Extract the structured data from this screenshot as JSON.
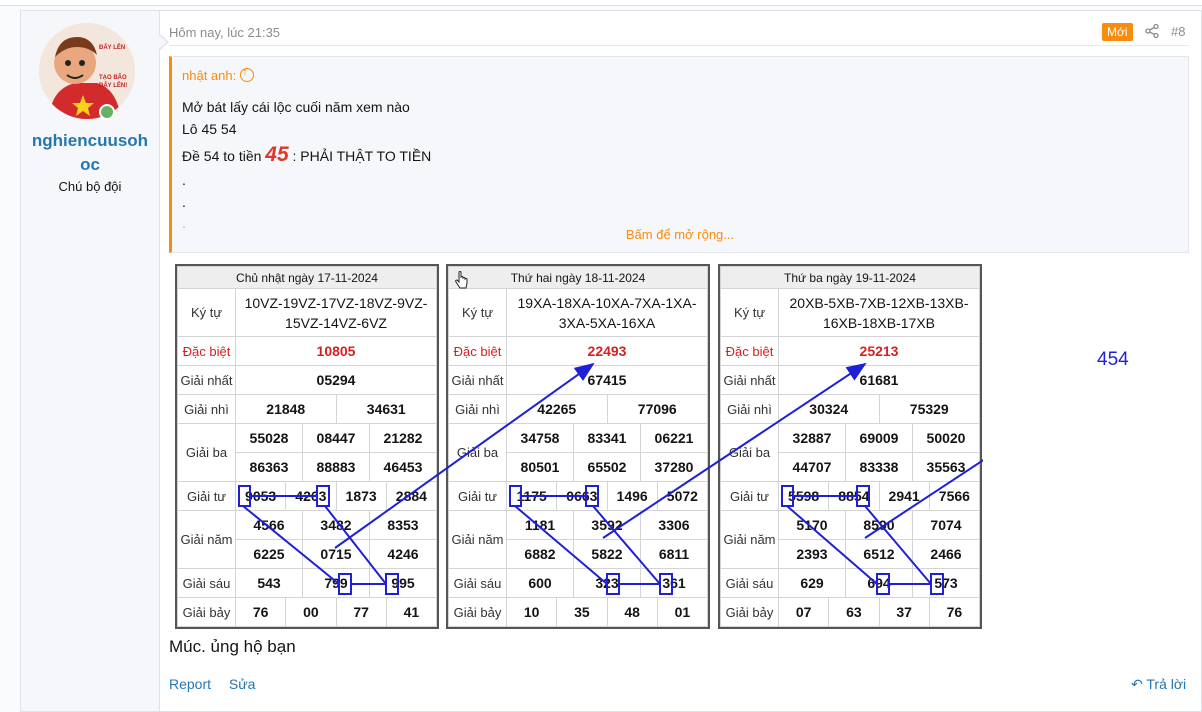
{
  "user": {
    "name": "nghiencuusohoc",
    "name_line1": "nghiencuusoh",
    "name_line2": "oc",
    "title": "Chú bộ đội",
    "avatar_text1": "ĐẨY LÊN",
    "avatar_text2": "TẠO BÃO",
    "avatar_text3": "ĐẨY LÊN!"
  },
  "post": {
    "date": "Hôm nay, lúc 21:35",
    "badge": "Mới",
    "number": "#8",
    "comment": "Múc. ủng hộ bạn",
    "actions": {
      "report": "Report",
      "edit": "Sửa",
      "reply": "Trả lời"
    }
  },
  "quote": {
    "author": "nhật anh:",
    "line1": "Mở bát lấy cái lộc cuối năm xem nào",
    "line2": "Lô 45 54",
    "line3_pre": "Đề 54 to tiền ",
    "line3_big": "45",
    "line3_post": " : PHẢI THẬT TO TIỀN",
    "dot1": ".",
    "dot2": ".",
    "dot3": ".",
    "expand": "Bấm để mở rộng..."
  },
  "annotation": "454",
  "labels": {
    "kytu": "Ký tự",
    "db": "Đặc biệt",
    "g1": "Giải nhất",
    "g2": "Giải nhì",
    "g3": "Giải ba",
    "g4": "Giải tư",
    "g5": "Giải năm",
    "g6": "Giải sáu",
    "g7": "Giải bảy"
  },
  "tables": [
    {
      "header": "Chủ nhật ngày 17-11-2024",
      "kytu": "10VZ-19VZ-17VZ-18VZ-9VZ-15VZ-14VZ-6VZ",
      "db": "10805",
      "g1": "05294",
      "g2": [
        "21848",
        "34631"
      ],
      "g3a": [
        "55028",
        "08447",
        "21282"
      ],
      "g3b": [
        "86363",
        "88883",
        "46453"
      ],
      "g4": [
        "9053",
        "4263",
        "1873",
        "2884"
      ],
      "g5a": [
        "4566",
        "3482",
        "8353"
      ],
      "g5b": [
        "6225",
        "0715",
        "4246"
      ],
      "g6": [
        "543",
        "799",
        "995"
      ],
      "g7": [
        "76",
        "00",
        "77",
        "41"
      ]
    },
    {
      "header": "Thứ hai ngày 18-11-2024",
      "kytu": "19XA-18XA-10XA-7XA-1XA-3XA-5XA-16XA",
      "db": "22493",
      "g1": "67415",
      "g2": [
        "42265",
        "77096"
      ],
      "g3a": [
        "34758",
        "83341",
        "06221"
      ],
      "g3b": [
        "80501",
        "65502",
        "37280"
      ],
      "g4": [
        "1175",
        "0663",
        "1496",
        "5072"
      ],
      "g5a": [
        "1181",
        "3592",
        "3306"
      ],
      "g5b": [
        "6882",
        "5822",
        "6811"
      ],
      "g6": [
        "600",
        "323",
        "361"
      ],
      "g7": [
        "10",
        "35",
        "48",
        "01"
      ]
    },
    {
      "header": "Thứ ba ngày 19-11-2024",
      "kytu": "20XB-5XB-7XB-12XB-13XB-16XB-18XB-17XB",
      "db": "25213",
      "g1": "61681",
      "g2": [
        "30324",
        "75329"
      ],
      "g3a": [
        "32887",
        "69009",
        "50020"
      ],
      "g3b": [
        "44707",
        "83338",
        "35563"
      ],
      "g4": [
        "5598",
        "8854",
        "2941",
        "7566"
      ],
      "g5a": [
        "5170",
        "8590",
        "7074"
      ],
      "g5b": [
        "2393",
        "6512",
        "2466"
      ],
      "g6": [
        "629",
        "694",
        "573"
      ],
      "g7": [
        "07",
        "63",
        "37",
        "76"
      ]
    }
  ]
}
